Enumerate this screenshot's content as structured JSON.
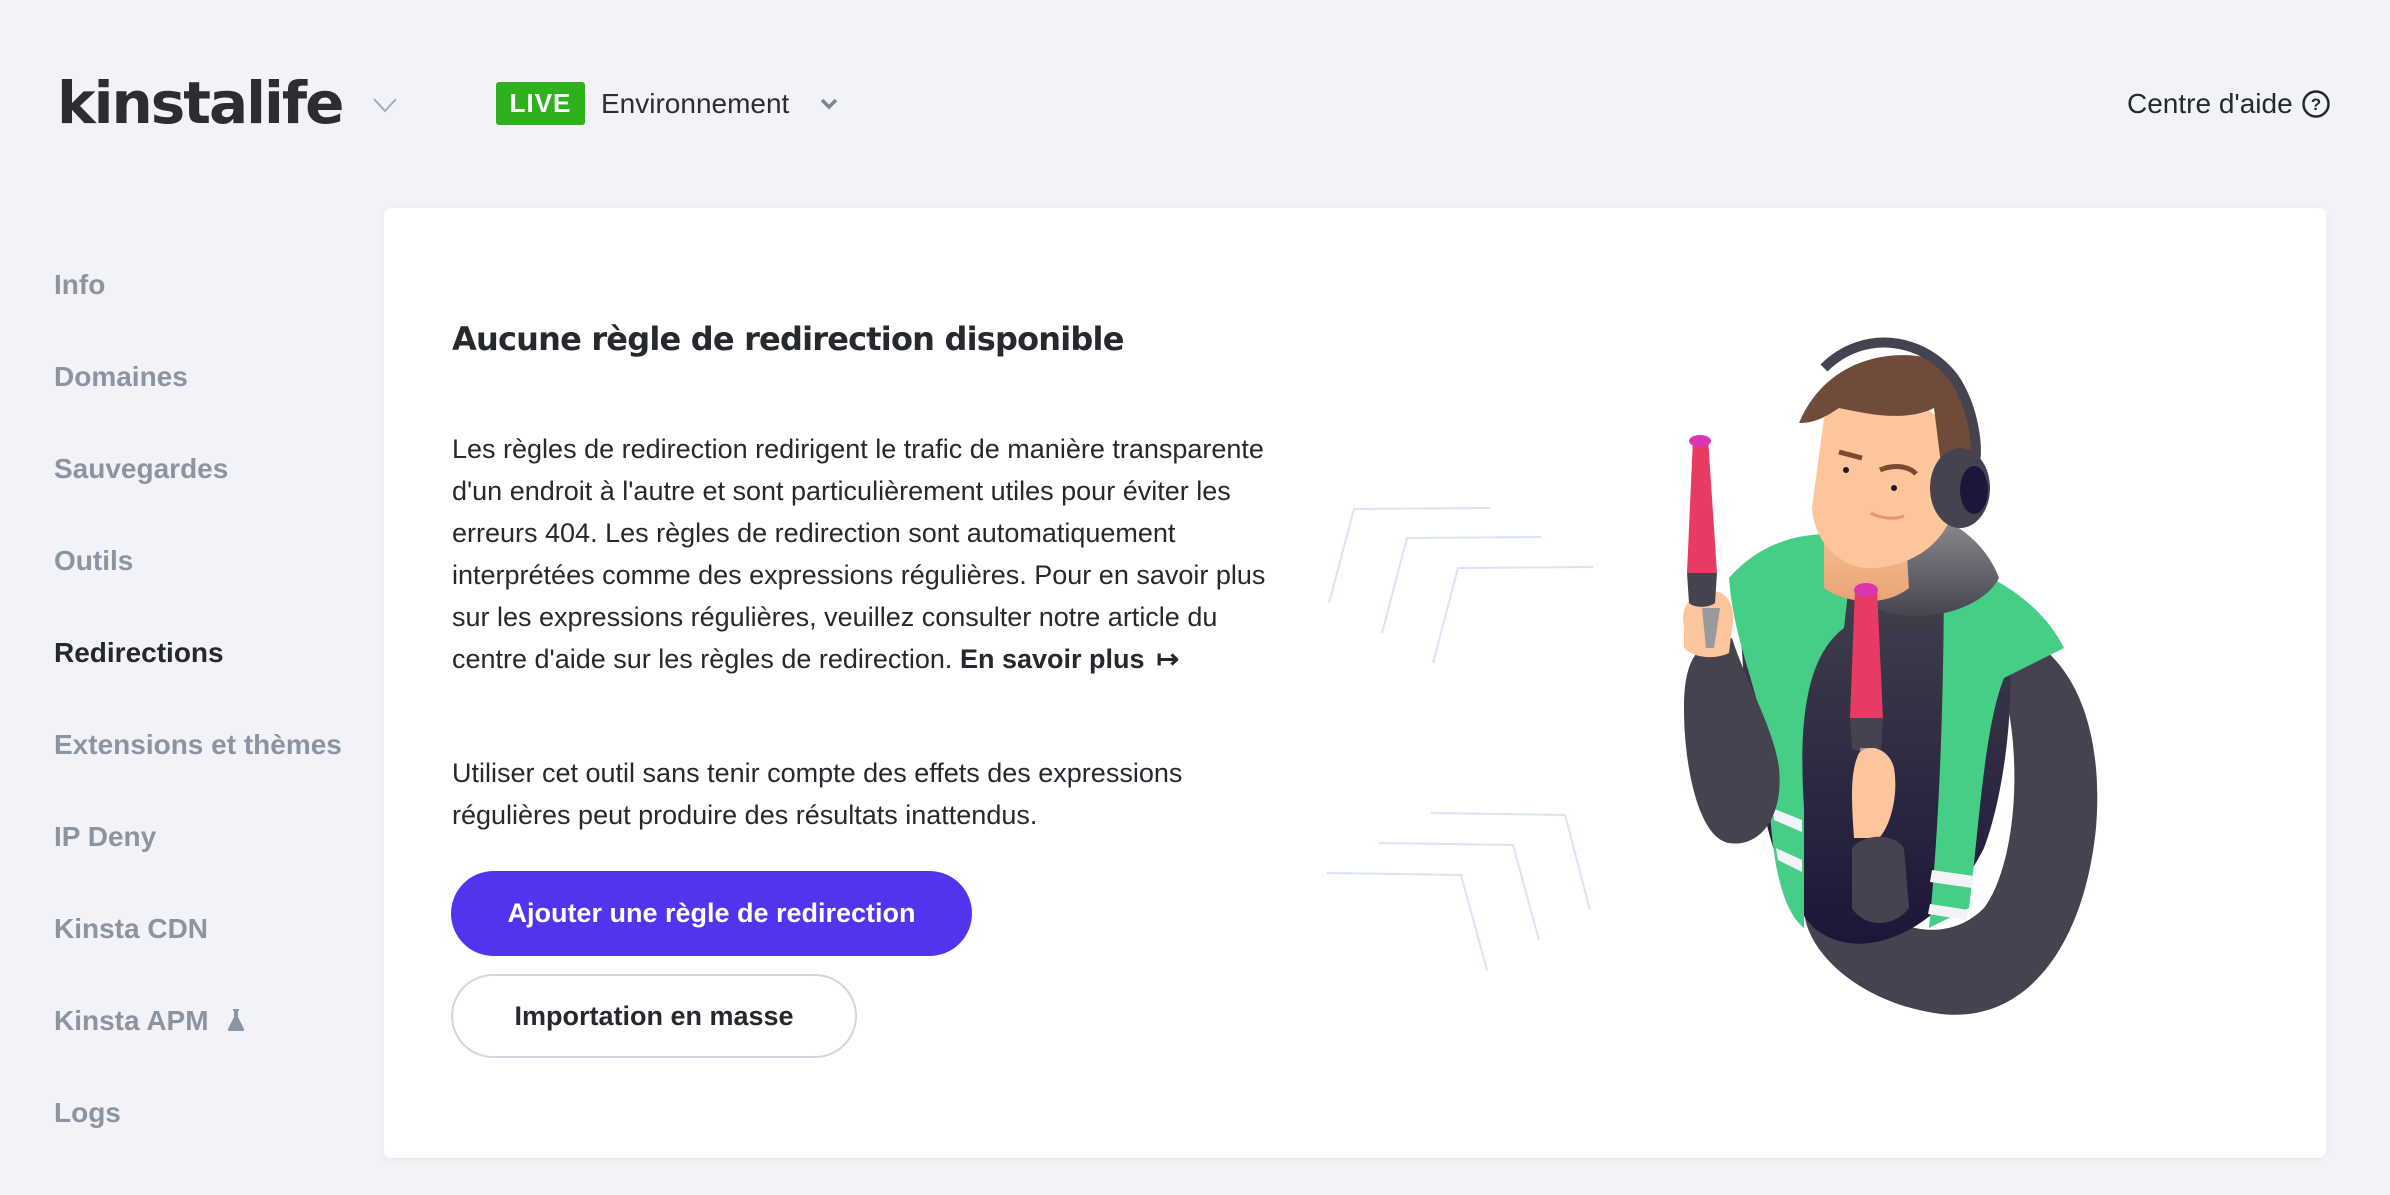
{
  "header": {
    "logo_text": "kinstalife",
    "environment_badge": "LIVE",
    "environment_label": "Environnement",
    "help_label": "Centre d'aide",
    "help_icon_glyph": "?"
  },
  "sidebar": {
    "items": [
      {
        "label": "Info",
        "active": false
      },
      {
        "label": "Domaines",
        "active": false
      },
      {
        "label": "Sauvegardes",
        "active": false
      },
      {
        "label": "Outils",
        "active": false
      },
      {
        "label": "Redirections",
        "active": true
      },
      {
        "label": "Extensions et thèmes",
        "active": false
      },
      {
        "label": "IP Deny",
        "active": false
      },
      {
        "label": "Kinsta CDN",
        "active": false
      },
      {
        "label": "Kinsta APM",
        "active": false,
        "icon": "flask-icon"
      },
      {
        "label": "Logs",
        "active": false
      }
    ]
  },
  "main": {
    "title": "Aucune règle de redirection disponible",
    "description": "Les règles de redirection redirigent le trafic de manière transparente d'un endroit à l'autre et sont particulièrement utiles pour éviter les erreurs 404. Les règles de redirection sont automatiquement interprétées comme des expressions régulières. Pour en savoir plus sur les expressions régulières, veuillez consulter notre article du centre d'aide sur les règles de redirection.",
    "learn_more_label": "En savoir plus",
    "learn_more_icon": "↦",
    "warning": "Utiliser cet outil sans tenir compte des effets des expressions régulières peut produire des résultats inattendus.",
    "primary_button": "Ajouter une règle de redirection",
    "secondary_button": "Importation en masse"
  },
  "colors": {
    "background": "#f2f3f8",
    "live_green": "#2eb11c",
    "primary_purple": "#5333ed",
    "nav_inactive": "#8a94a3",
    "text_dark": "#25282d"
  }
}
